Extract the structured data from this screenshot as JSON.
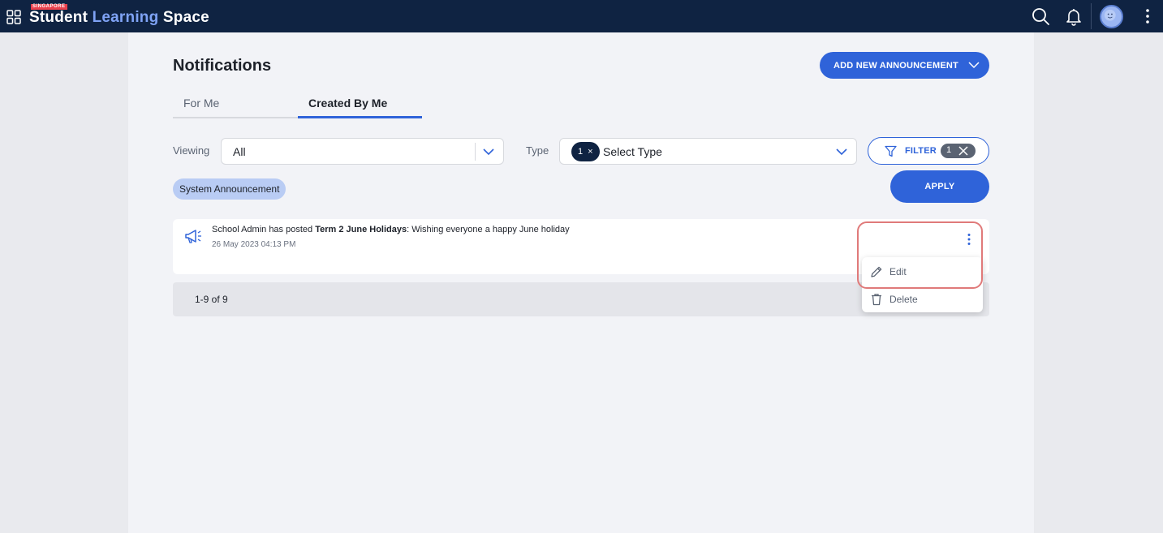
{
  "topbar": {
    "brand_flag": "SINGAPORE",
    "brand_part1": "Student ",
    "brand_part2": "Learning",
    "brand_part3": " Space",
    "icons": [
      "apps-grid-icon",
      "search-icon",
      "bell-icon",
      "avatar",
      "more-vertical-icon"
    ]
  },
  "page": {
    "title": "Notifications",
    "add_button_label": "ADD NEW ANNOUNCEMENT"
  },
  "tabs": [
    {
      "label": "For Me",
      "active": false
    },
    {
      "label": "Created By Me",
      "active": true
    }
  ],
  "filters": {
    "viewing_label": "Viewing",
    "viewing_value": "All",
    "type_label": "Type",
    "type_count": "1",
    "type_remove": "×",
    "type_placeholder": "Select Type",
    "filter_label": "FILTER",
    "filter_count": "1",
    "active_chip": "System Announcement",
    "apply_label": "APPLY"
  },
  "notifications": [
    {
      "actor": "School Admin has posted ",
      "title": "Term 2 June Holidays",
      "message": ": Wishing everyone a happy June holiday",
      "time": "26 May 2023 04:13 PM"
    }
  ],
  "pagination": {
    "text": "1-9 of 9"
  },
  "context_menu": {
    "items": [
      {
        "label": "Edit",
        "icon": "pencil-icon"
      },
      {
        "label": "Delete",
        "icon": "trash-icon"
      }
    ]
  },
  "colors": {
    "topbar": "#0f2342",
    "primary": "#2f63d9",
    "highlight": "#e07a7a",
    "brand_accent": "#7fa3f5"
  }
}
